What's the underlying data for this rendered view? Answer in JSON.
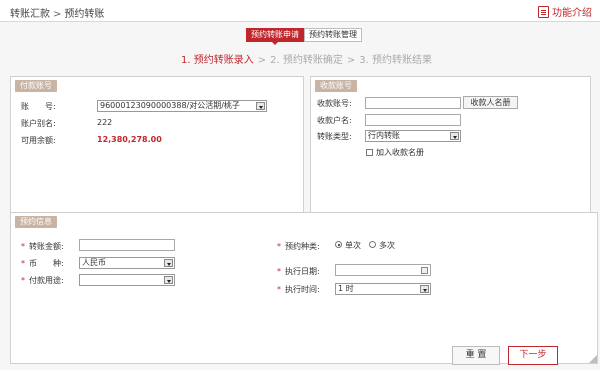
{
  "header": {
    "breadcrumb": [
      "转账汇款",
      "预约转账"
    ],
    "breadcrumb_sep": ">",
    "help_label": "功能介绍"
  },
  "tabs": [
    {
      "label": "预约转账申请",
      "active": true
    },
    {
      "label": "预约转账管理",
      "active": false
    }
  ],
  "steps": {
    "items": [
      "1. 预约转账录入",
      "2. 预约转账确定",
      "3. 预约转账结果"
    ],
    "current": 0,
    "sep": ">"
  },
  "payer": {
    "title": "付款账号",
    "account_label": "账　　号:",
    "account_value": "96000123090000388/对公活期/桃子",
    "alias_label": "账户别名:",
    "alias_value": "222",
    "balance_label": "可用余额:",
    "balance_value": "12,380,278.00"
  },
  "payee": {
    "title": "收款账号",
    "account_label": "收款账号:",
    "account_value": "",
    "name_button": "收款人名册",
    "name_label": "收款户名:",
    "name_value": "",
    "type_label": "转账类型:",
    "type_value": "行内转账",
    "add_label": "加入收款名册"
  },
  "booking": {
    "title": "预约信息",
    "amount_label": "转账金额:",
    "amount_value": "",
    "currency_label": "币　　种:",
    "currency_value": "人民币",
    "purpose_label": "付款用途:",
    "purpose_value": "",
    "kind_label": "预约种类:",
    "kind_options": [
      "单次",
      "多次"
    ],
    "kind_selected": 0,
    "date_label": "执行日期:",
    "date_value": "",
    "time_label": "执行时间:",
    "time_value": "1 时"
  },
  "actions": {
    "reset_label": "重 置",
    "next_label": "下一步"
  },
  "colors": {
    "accent": "#c0272d",
    "panel_tag": "#c9b3a3"
  }
}
